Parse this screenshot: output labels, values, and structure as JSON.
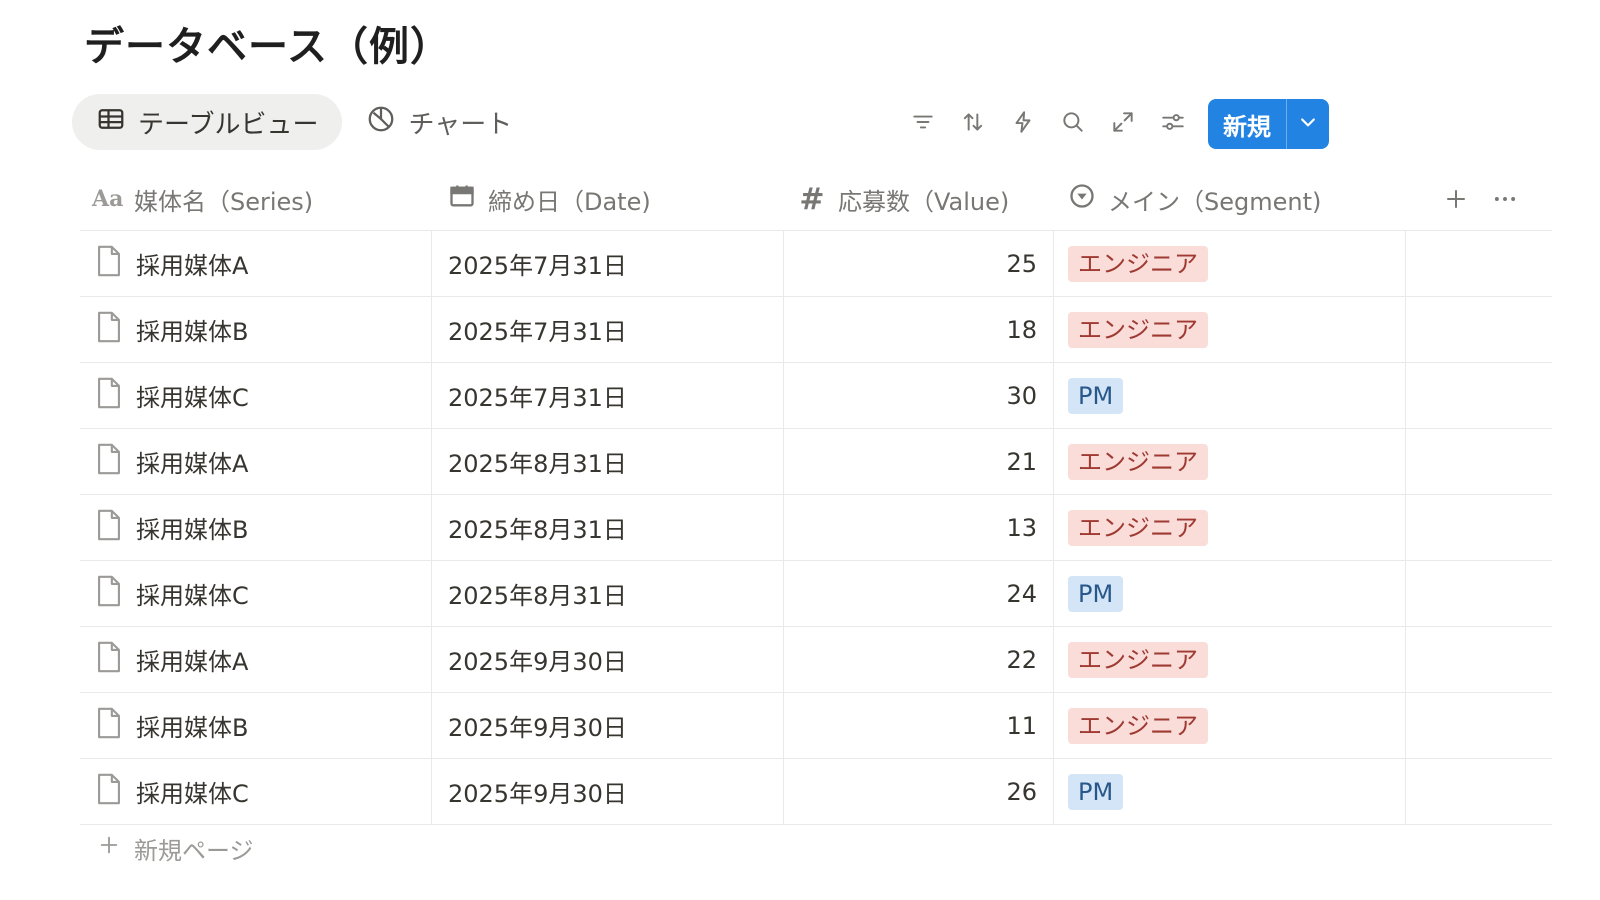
{
  "page": {
    "title": "データベース（例）"
  },
  "views": [
    {
      "label": "テーブルビュー",
      "icon": "table-icon",
      "active": true
    },
    {
      "label": "チャート",
      "icon": "chart-icon",
      "active": false
    }
  ],
  "toolbar": {
    "icons": [
      "filter-icon",
      "sort-icon",
      "automation-icon",
      "search-icon",
      "expand-icon",
      "settings-icon"
    ],
    "new_label": "新規"
  },
  "columns": [
    {
      "label": "媒体名（Series)",
      "icon": "text-type-icon"
    },
    {
      "label": "締め日（Date)",
      "icon": "calendar-icon"
    },
    {
      "label": "応募数（Value)",
      "icon": "number-icon"
    },
    {
      "label": "メイン（Segment)",
      "icon": "select-icon"
    }
  ],
  "colors": {
    "tag_engineer_bg": "#fadcd9",
    "tag_engineer_fg": "#9f3a32",
    "tag_pm_bg": "#d3e5f6",
    "tag_pm_fg": "#28588a",
    "accent": "#2383e2"
  },
  "rows": [
    {
      "name": "採用媒体A",
      "date": "2025年7月31日",
      "value": "25",
      "segment": "エンジニア",
      "segment_type": "engineer"
    },
    {
      "name": "採用媒体B",
      "date": "2025年7月31日",
      "value": "18",
      "segment": "エンジニア",
      "segment_type": "engineer"
    },
    {
      "name": "採用媒体C",
      "date": "2025年7月31日",
      "value": "30",
      "segment": "PM",
      "segment_type": "pm"
    },
    {
      "name": "採用媒体A",
      "date": "2025年8月31日",
      "value": "21",
      "segment": "エンジニア",
      "segment_type": "engineer"
    },
    {
      "name": "採用媒体B",
      "date": "2025年8月31日",
      "value": "13",
      "segment": "エンジニア",
      "segment_type": "engineer"
    },
    {
      "name": "採用媒体C",
      "date": "2025年8月31日",
      "value": "24",
      "segment": "PM",
      "segment_type": "pm"
    },
    {
      "name": "採用媒体A",
      "date": "2025年9月30日",
      "value": "22",
      "segment": "エンジニア",
      "segment_type": "engineer"
    },
    {
      "name": "採用媒体B",
      "date": "2025年9月30日",
      "value": "11",
      "segment": "エンジニア",
      "segment_type": "engineer"
    },
    {
      "name": "採用媒体C",
      "date": "2025年9月30日",
      "value": "26",
      "segment": "PM",
      "segment_type": "pm"
    }
  ],
  "footer": {
    "add_label": "新規ページ"
  }
}
